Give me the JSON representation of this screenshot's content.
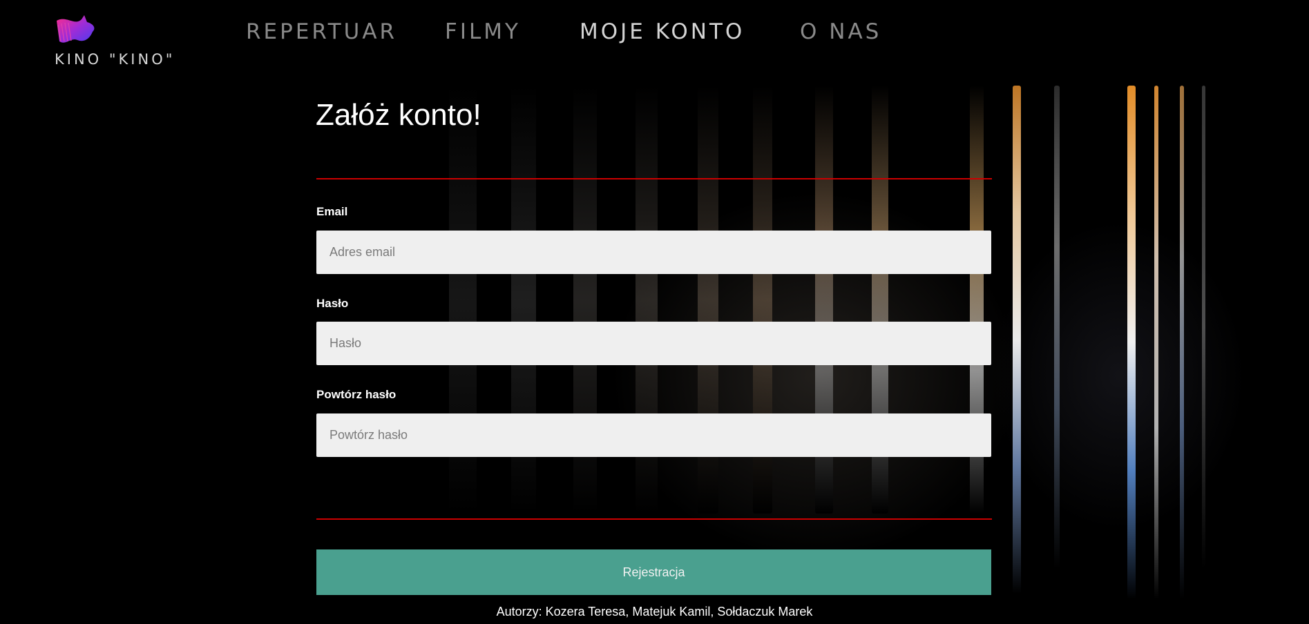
{
  "brand": {
    "name": "KINO \"KINO\"",
    "logo_icon": "film-wave-logo"
  },
  "nav": {
    "items": [
      {
        "label": "REPERTUAR",
        "active": false
      },
      {
        "label": "FILMY",
        "active": false
      },
      {
        "label": "MOJE KONTO",
        "active": true
      },
      {
        "label": "O NAS",
        "active": false
      }
    ]
  },
  "form": {
    "title": "Załóż konto!",
    "email_label": "Email",
    "email_placeholder": "Adres email",
    "password_label": "Hasło",
    "password_placeholder": "Hasło",
    "repeat_label": "Powtórz hasło",
    "repeat_placeholder": "Powtórz hasło",
    "submit_label": "Rejestracja"
  },
  "footer": {
    "authors": "Autorzy: Kozera Teresa, Matejuk Kamil, Sołdaczuk Marek"
  },
  "colors": {
    "background": "#000000",
    "accent_rule": "#cc0000",
    "submit_button": "#4aa08f",
    "nav_inactive": "#8a8a8a",
    "nav_active": "#d4d4d4",
    "input_bg": "#efefef"
  }
}
